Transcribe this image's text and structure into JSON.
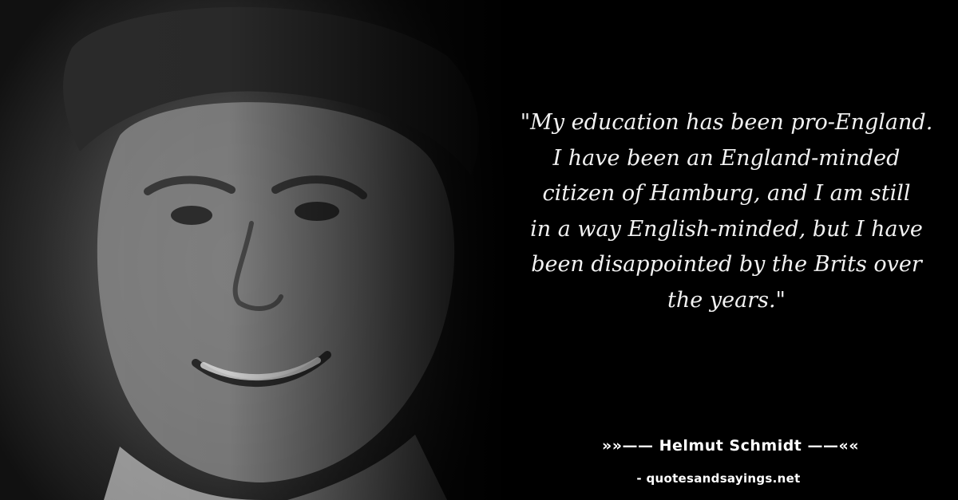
{
  "quote": {
    "text": "\"My education has been pro-England.\nI have been an England-minded\ncitizen of Hamburg, and I am still\nin a way English-minded, but I have\nbeen disappointed by the Brits over\nthe years.\""
  },
  "author": {
    "line": "»»—— Helmut Schmidt ——««"
  },
  "source": {
    "line": "- quotesandsayings.net"
  },
  "colors": {
    "background": "#000000",
    "text": "#f2f2f2"
  }
}
